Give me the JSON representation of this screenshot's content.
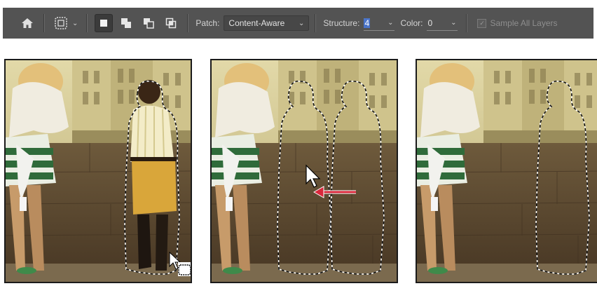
{
  "toolbar": {
    "home_icon": "home-icon",
    "tool_icon": "patch-tool-icon",
    "selection_modes": [
      "new-selection-icon",
      "add-to-selection-icon",
      "subtract-from-selection-icon",
      "intersect-selection-icon"
    ],
    "patch_label": "Patch:",
    "patch_value": "Content-Aware",
    "structure_label": "Structure:",
    "structure_value": "4",
    "color_label": "Color:",
    "color_value": "0",
    "sample_all_layers_label": "Sample All Layers",
    "sample_all_layers_checked": true,
    "sample_all_layers_enabled": false
  },
  "colors": {
    "toolbar_bg": "#535353",
    "arrow_red": "#d8283b",
    "photo_sky": "#d9cf9a",
    "photo_wall": "#5a4630"
  }
}
